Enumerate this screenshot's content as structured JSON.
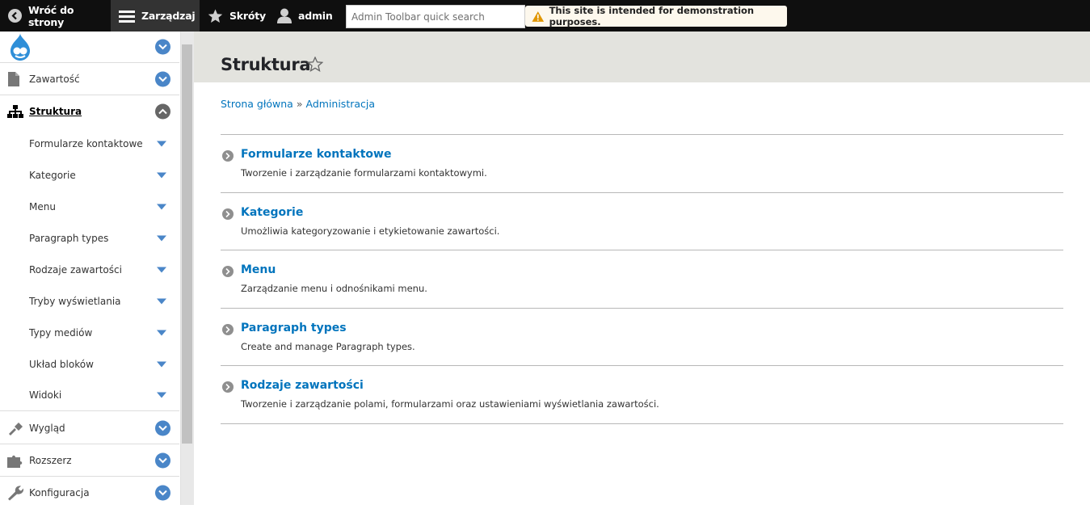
{
  "toolbar": {
    "back_label": "Wróć do strony",
    "manage_label": "Zarządzaj",
    "shortcuts_label": "Skróty",
    "user_label": "admin",
    "search_placeholder": "Admin Toolbar quick search",
    "notice": "This site is intended for demonstration purposes."
  },
  "sidebar": {
    "items": [
      {
        "label": "Zawartość",
        "icon": "file-icon"
      },
      {
        "label": "Struktura",
        "icon": "structure-icon",
        "active": true
      },
      {
        "label": "Wygląd",
        "icon": "brush-icon"
      },
      {
        "label": "Rozszerz",
        "icon": "puzzle-icon"
      },
      {
        "label": "Konfiguracja",
        "icon": "wrench-icon"
      }
    ],
    "subitems": [
      {
        "label": "Formularze kontaktowe"
      },
      {
        "label": "Kategorie"
      },
      {
        "label": "Menu"
      },
      {
        "label": "Paragraph types"
      },
      {
        "label": "Rodzaje zawartości"
      },
      {
        "label": "Tryby wyświetlania"
      },
      {
        "label": "Typy mediów"
      },
      {
        "label": "Układ bloków"
      },
      {
        "label": "Widoki"
      }
    ]
  },
  "page": {
    "title": "Struktura",
    "breadcrumb": [
      "Strona główna",
      "Administracja"
    ],
    "breadcrumb_sep": "»"
  },
  "entries": [
    {
      "title": "Formularze kontaktowe",
      "desc": "Tworzenie i zarządzanie formularzami kontaktowymi."
    },
    {
      "title": "Kategorie",
      "desc": "Umożliwia kategoryzowanie i etykietowanie zawartości."
    },
    {
      "title": "Menu",
      "desc": "Zarządzanie menu i odnośnikami menu."
    },
    {
      "title": "Paragraph types",
      "desc": "Create and manage Paragraph types."
    },
    {
      "title": "Rodzaje zawartości",
      "desc": "Tworzenie i zarządzanie polami, formularzami oraz ustawieniami wyświetlania zawartości."
    }
  ],
  "colors": {
    "link": "#0074bd",
    "toggle": "#4a86c8",
    "toolbar_bg": "#0f0f0f",
    "header_bg": "#e3e3de"
  }
}
